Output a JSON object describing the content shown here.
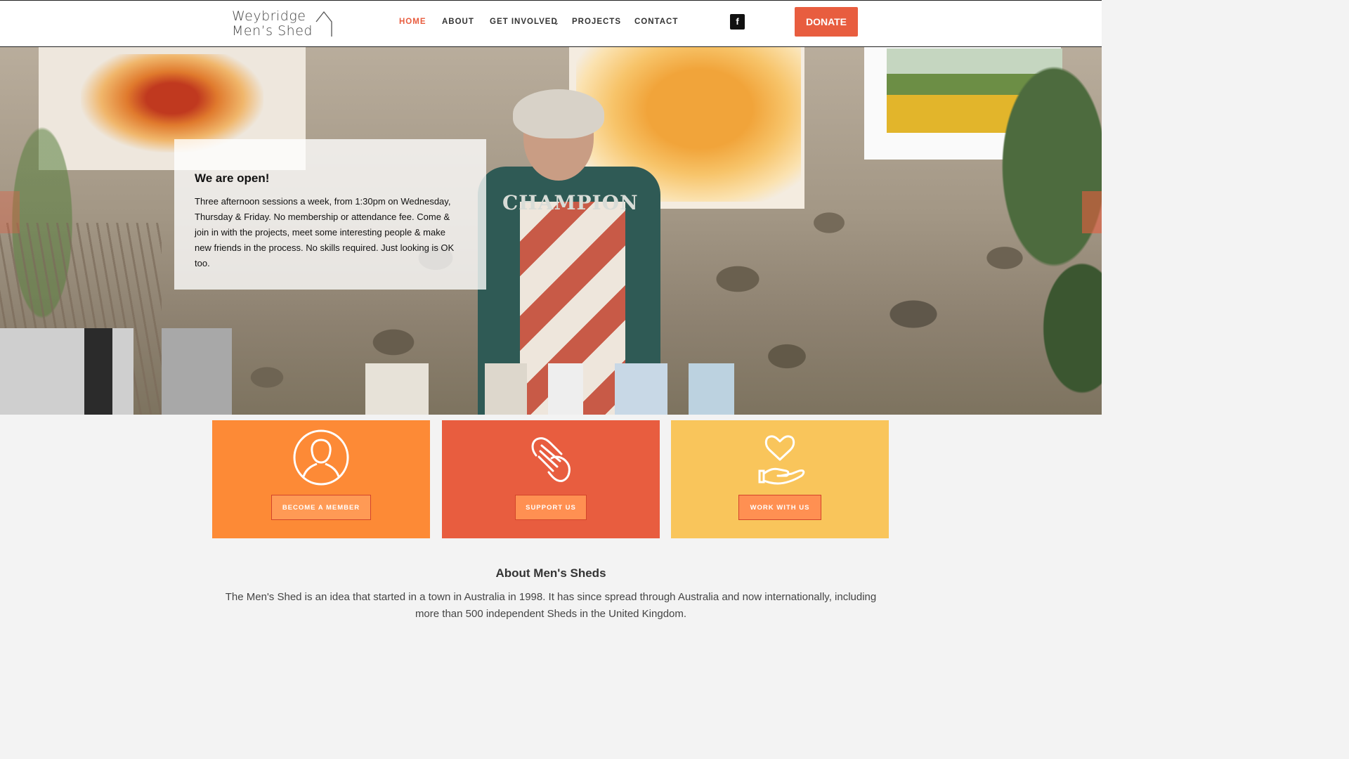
{
  "header": {
    "logo_line1": "Weybridge",
    "logo_line2": "Men’s Shed",
    "nav": [
      {
        "label": "HOME",
        "active": true
      },
      {
        "label": "ABOUT"
      },
      {
        "label": "GET INVOLVED",
        "has_dropdown": true
      },
      {
        "label": "PROJECTS"
      },
      {
        "label": "CONTACT"
      }
    ],
    "social_icon": "facebook-icon",
    "facebook_glyph": "f",
    "donate_label": "DONATE"
  },
  "hero": {
    "title": "We are open!",
    "text": "Three afternoon sessions a week, from 1:30pm on Wednesday, Thursday & Friday. No membership or attendance fee. Come & join in with the projects, meet some interesting people & make new friends in the process. No skills required. Just looking is OK too.",
    "shirt_text": "CHAMPION"
  },
  "cards": [
    {
      "icon": "person-icon",
      "button": "BECOME A MEMBER",
      "color": "#fd8a36"
    },
    {
      "icon": "handshake-icon",
      "button": "SUPPORT US",
      "color": "#e85d3f"
    },
    {
      "icon": "heart-hand-icon",
      "button": "WORK WITH US",
      "color": "#f9c55b"
    }
  ],
  "about": {
    "title": "About Men's Sheds",
    "text": "The Men's Shed is an idea that started in a town in Australia in 1998. It has since spread through Australia and now internationally, including more than 500 independent Sheds in the United Kingdom."
  },
  "colors": {
    "accent": "#e85d3f",
    "orange": "#fd8a36",
    "yellow": "#f9c55b"
  }
}
